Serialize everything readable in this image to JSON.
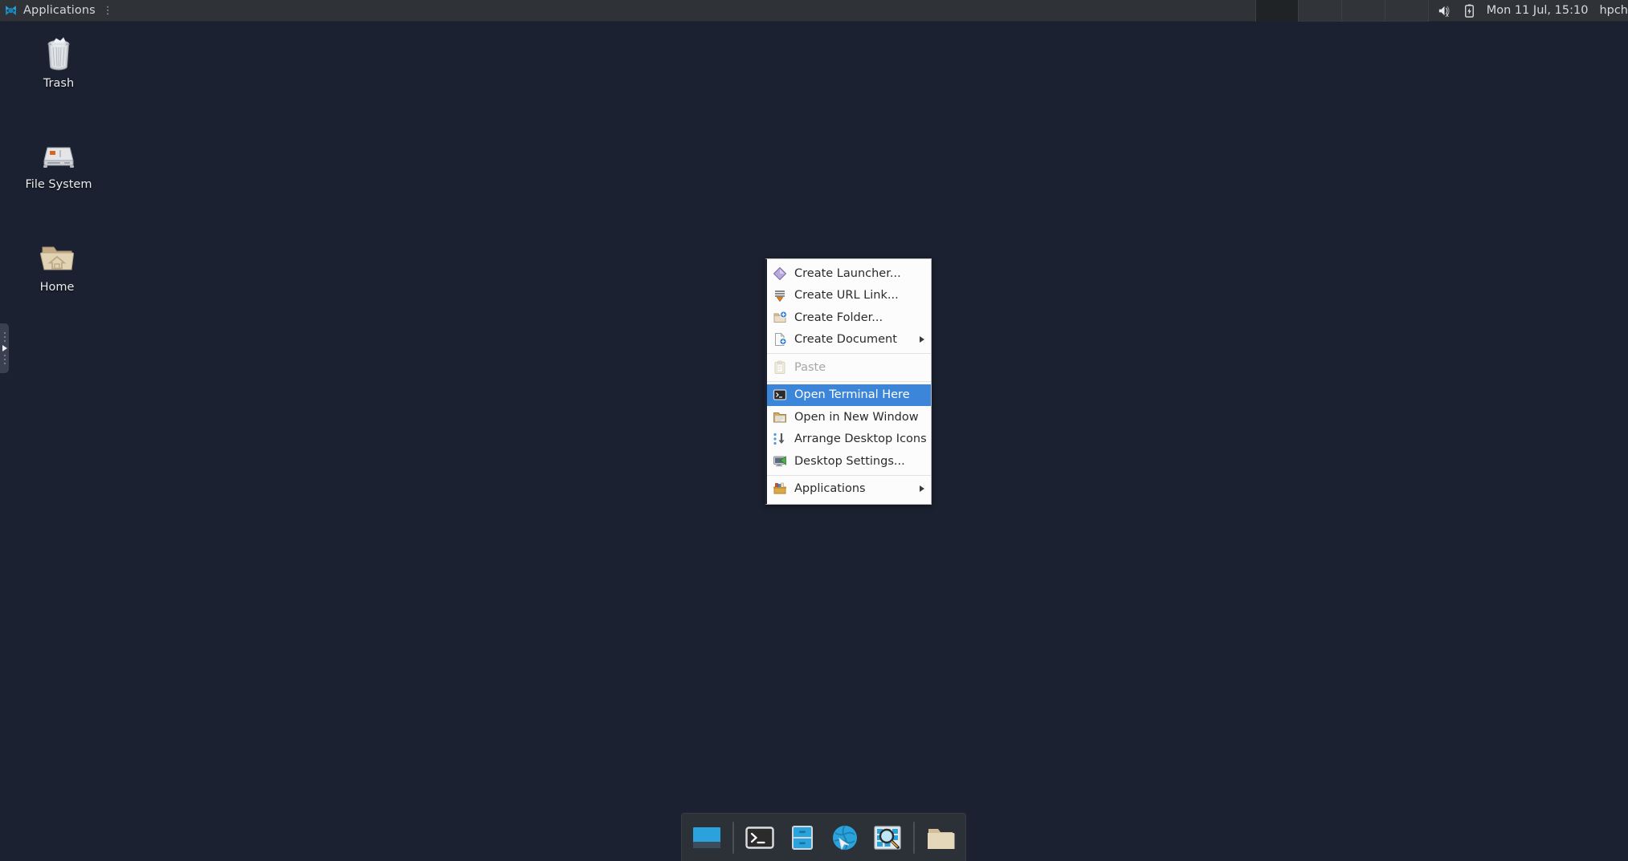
{
  "desktop": {
    "background_color": "#1b2130",
    "icons": [
      {
        "label": "Trash",
        "icon": "trash-icon"
      },
      {
        "label": "File System",
        "icon": "harddisk-icon"
      },
      {
        "label": "Home",
        "icon": "home-folder-icon"
      }
    ]
  },
  "panel": {
    "background_color": "#2f3337",
    "applications_label": "Applications",
    "applications_dots": "⋮",
    "workspace_count": 4,
    "active_workspace": 1,
    "tray": [
      {
        "name": "volume-muted-icon"
      },
      {
        "name": "battery-charging-icon"
      }
    ],
    "clock": "Mon 11 Jul, 15:10",
    "user": "hpch"
  },
  "left_panel_handle": {
    "name": "hidden-panel-handle"
  },
  "context_menu": {
    "highlight_color": "#3b86d8",
    "items": [
      {
        "label": "Create Launcher...",
        "icon": "launcher-icon",
        "state": "normal",
        "submenu": false
      },
      {
        "label": "Create URL Link...",
        "icon": "url-link-icon",
        "state": "normal",
        "submenu": false
      },
      {
        "label": "Create Folder...",
        "icon": "new-folder-icon",
        "state": "normal",
        "submenu": false
      },
      {
        "label": "Create Document",
        "icon": "new-document-icon",
        "state": "normal",
        "submenu": true
      },
      {
        "separator_before": true,
        "label": "Paste",
        "icon": "paste-icon",
        "state": "disabled",
        "submenu": false
      },
      {
        "separator_before": true,
        "label": "Open Terminal Here",
        "icon": "terminal-icon",
        "state": "selected",
        "submenu": false
      },
      {
        "label": "Open in New Window",
        "icon": "folder-open-icon",
        "state": "normal",
        "submenu": false
      },
      {
        "label": "Arrange Desktop Icons",
        "icon": "arrange-icons-icon",
        "state": "normal",
        "submenu": false
      },
      {
        "label": "Desktop Settings...",
        "icon": "desktop-settings-icon",
        "state": "normal",
        "submenu": false
      },
      {
        "separator_before": true,
        "label": "Applications",
        "icon": "applications-icon",
        "state": "normal",
        "submenu": true
      }
    ]
  },
  "dock": {
    "background_color": "#2c3137",
    "items": [
      {
        "name": "show-desktop-icon",
        "type": "icon"
      },
      {
        "name": "dock-separator-1",
        "type": "separator"
      },
      {
        "name": "terminal-icon",
        "type": "icon"
      },
      {
        "name": "file-manager-icon",
        "type": "icon"
      },
      {
        "name": "web-browser-icon",
        "type": "icon"
      },
      {
        "name": "app-finder-icon",
        "type": "icon"
      },
      {
        "name": "dock-separator-2",
        "type": "separator"
      },
      {
        "name": "folder-icon",
        "type": "icon"
      }
    ]
  }
}
